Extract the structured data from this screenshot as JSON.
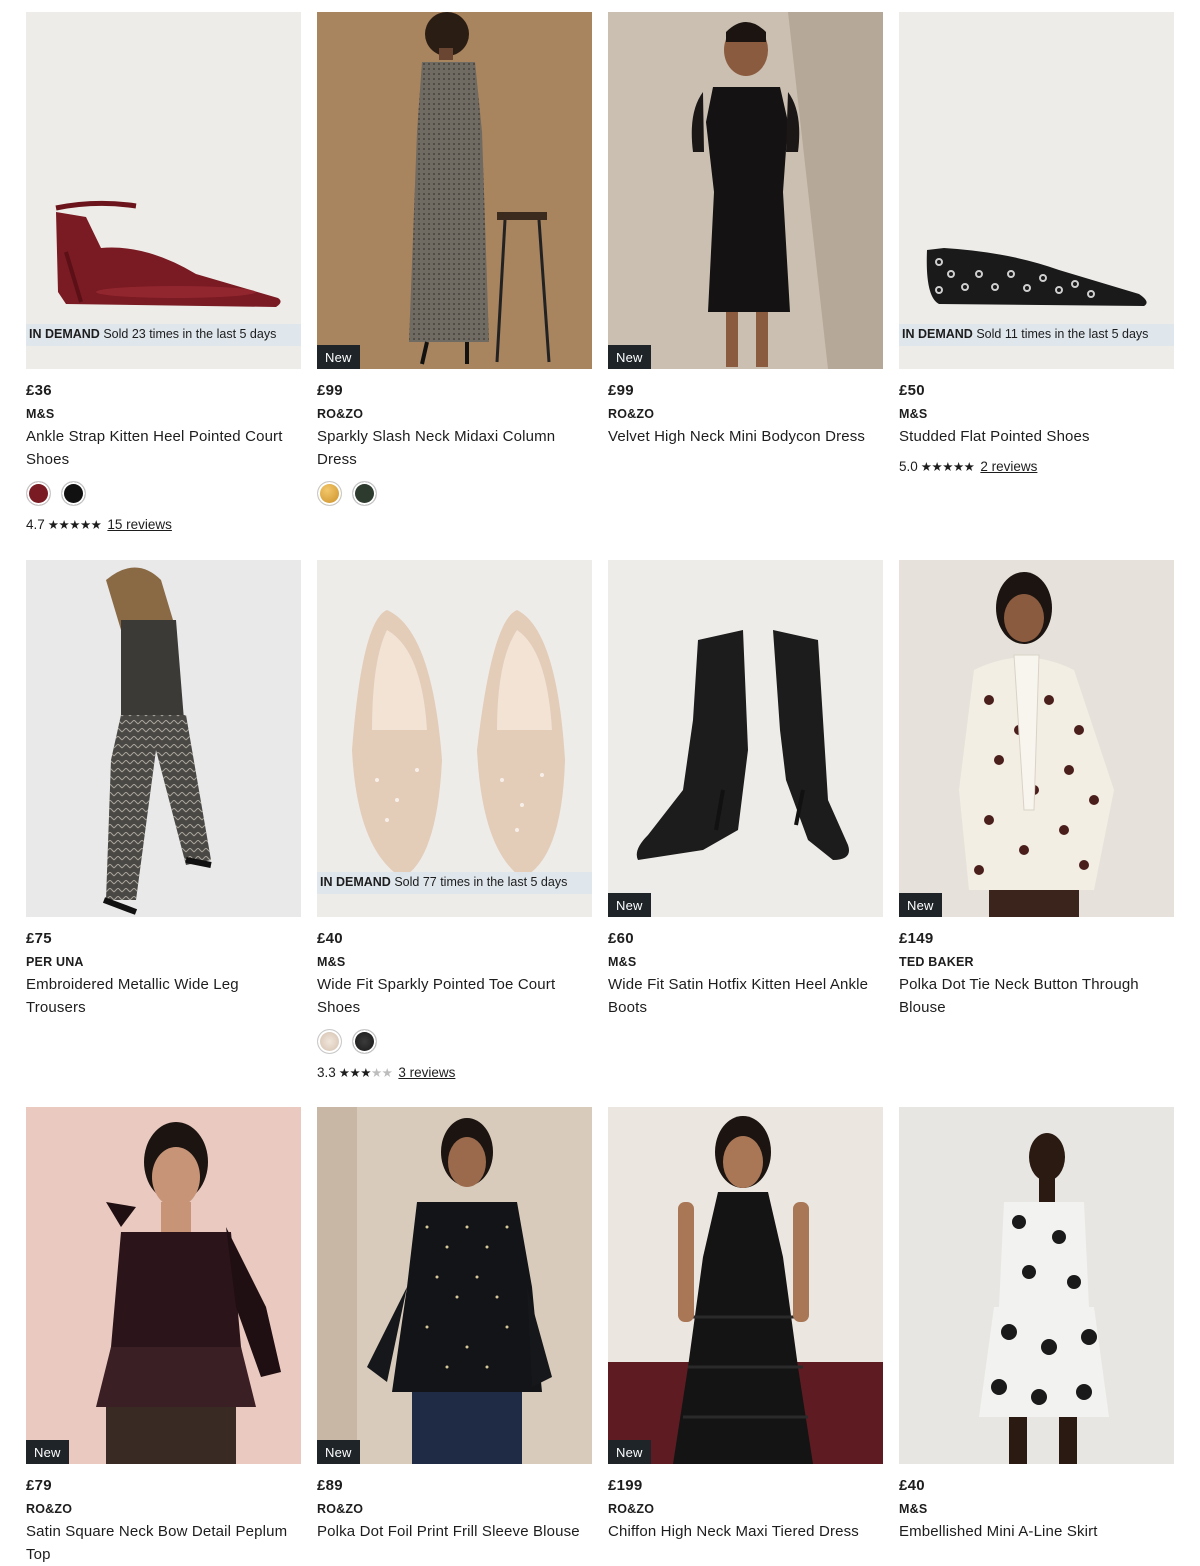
{
  "products": [
    {
      "price": "£36",
      "brand": "M&S",
      "title": "Ankle Strap Kitten Heel Pointed Court Shoes",
      "badge": "",
      "demand_label": "IN DEMAND",
      "demand_text": "Sold 23 times in the last 5 days",
      "swatches": [
        "#7a1a22",
        "#111111"
      ],
      "rating": "4.7",
      "stars": 4.7,
      "reviews": "15 reviews"
    },
    {
      "price": "£99",
      "brand": "RO&ZO",
      "title": "Sparkly Slash Neck Midaxi Column Dress",
      "badge": "New",
      "demand_label": "",
      "demand_text": "",
      "swatches": [
        "#d9a23a",
        "#2d3a2e"
      ],
      "rating": "",
      "stars": 0,
      "reviews": ""
    },
    {
      "price": "£99",
      "brand": "RO&ZO",
      "title": "Velvet High Neck Mini Bodycon Dress",
      "badge": "New",
      "demand_label": "",
      "demand_text": "",
      "swatches": [],
      "rating": "",
      "stars": 0,
      "reviews": ""
    },
    {
      "price": "£50",
      "brand": "M&S",
      "title": "Studded Flat Pointed Shoes",
      "badge": "",
      "demand_label": "IN DEMAND",
      "demand_text": "Sold 11 times in the last 5 days",
      "swatches": [],
      "rating": "5.0",
      "stars": 5,
      "reviews": "2 reviews"
    },
    {
      "price": "£75",
      "brand": "PER UNA",
      "title": "Embroidered Metallic Wide Leg Trousers",
      "badge": "",
      "demand_label": "",
      "demand_text": "",
      "swatches": [],
      "rating": "",
      "stars": 0,
      "reviews": ""
    },
    {
      "price": "£40",
      "brand": "M&S",
      "title": "Wide Fit Sparkly Pointed Toe Court Shoes",
      "badge": "",
      "demand_label": "IN DEMAND",
      "demand_text": "Sold 77 times in the last 5 days",
      "swatches": [
        "#e6d9cc",
        "#1c1c1c"
      ],
      "rating": "3.3",
      "stars": 3.3,
      "reviews": "3 reviews"
    },
    {
      "price": "£60",
      "brand": "M&S",
      "title": "Wide Fit Satin Hotfix Kitten Heel Ankle Boots",
      "badge": "New",
      "demand_label": "",
      "demand_text": "",
      "swatches": [],
      "rating": "",
      "stars": 0,
      "reviews": ""
    },
    {
      "price": "£149",
      "brand": "TED BAKER",
      "title": "Polka Dot Tie Neck Button Through Blouse",
      "badge": "New",
      "demand_label": "",
      "demand_text": "",
      "swatches": [],
      "rating": "",
      "stars": 0,
      "reviews": ""
    },
    {
      "price": "£79",
      "brand": "RO&ZO",
      "title": "Satin Square Neck Bow Detail Peplum Top",
      "badge": "New",
      "demand_label": "",
      "demand_text": "",
      "swatches": [],
      "rating": "",
      "stars": 0,
      "reviews": ""
    },
    {
      "price": "£89",
      "brand": "RO&ZO",
      "title": "Polka Dot Foil Print Frill Sleeve Blouse",
      "badge": "New",
      "demand_label": "",
      "demand_text": "",
      "swatches": [],
      "rating": "",
      "stars": 0,
      "reviews": ""
    },
    {
      "price": "£199",
      "brand": "RO&ZO",
      "title": "Chiffon High Neck Maxi Tiered Dress",
      "badge": "New",
      "demand_label": "",
      "demand_text": "",
      "swatches": [],
      "rating": "",
      "stars": 0,
      "reviews": ""
    },
    {
      "price": "£40",
      "brand": "M&S",
      "title": "Embellished Mini A-Line Skirt",
      "badge": "",
      "demand_label": "",
      "demand_text": "",
      "swatches": [],
      "rating": "",
      "stars": 0,
      "reviews": ""
    }
  ],
  "colors": {
    "badge_bg": "#1e2428",
    "demand_bg": "#dde6ec",
    "text": "#1d1d1d"
  }
}
